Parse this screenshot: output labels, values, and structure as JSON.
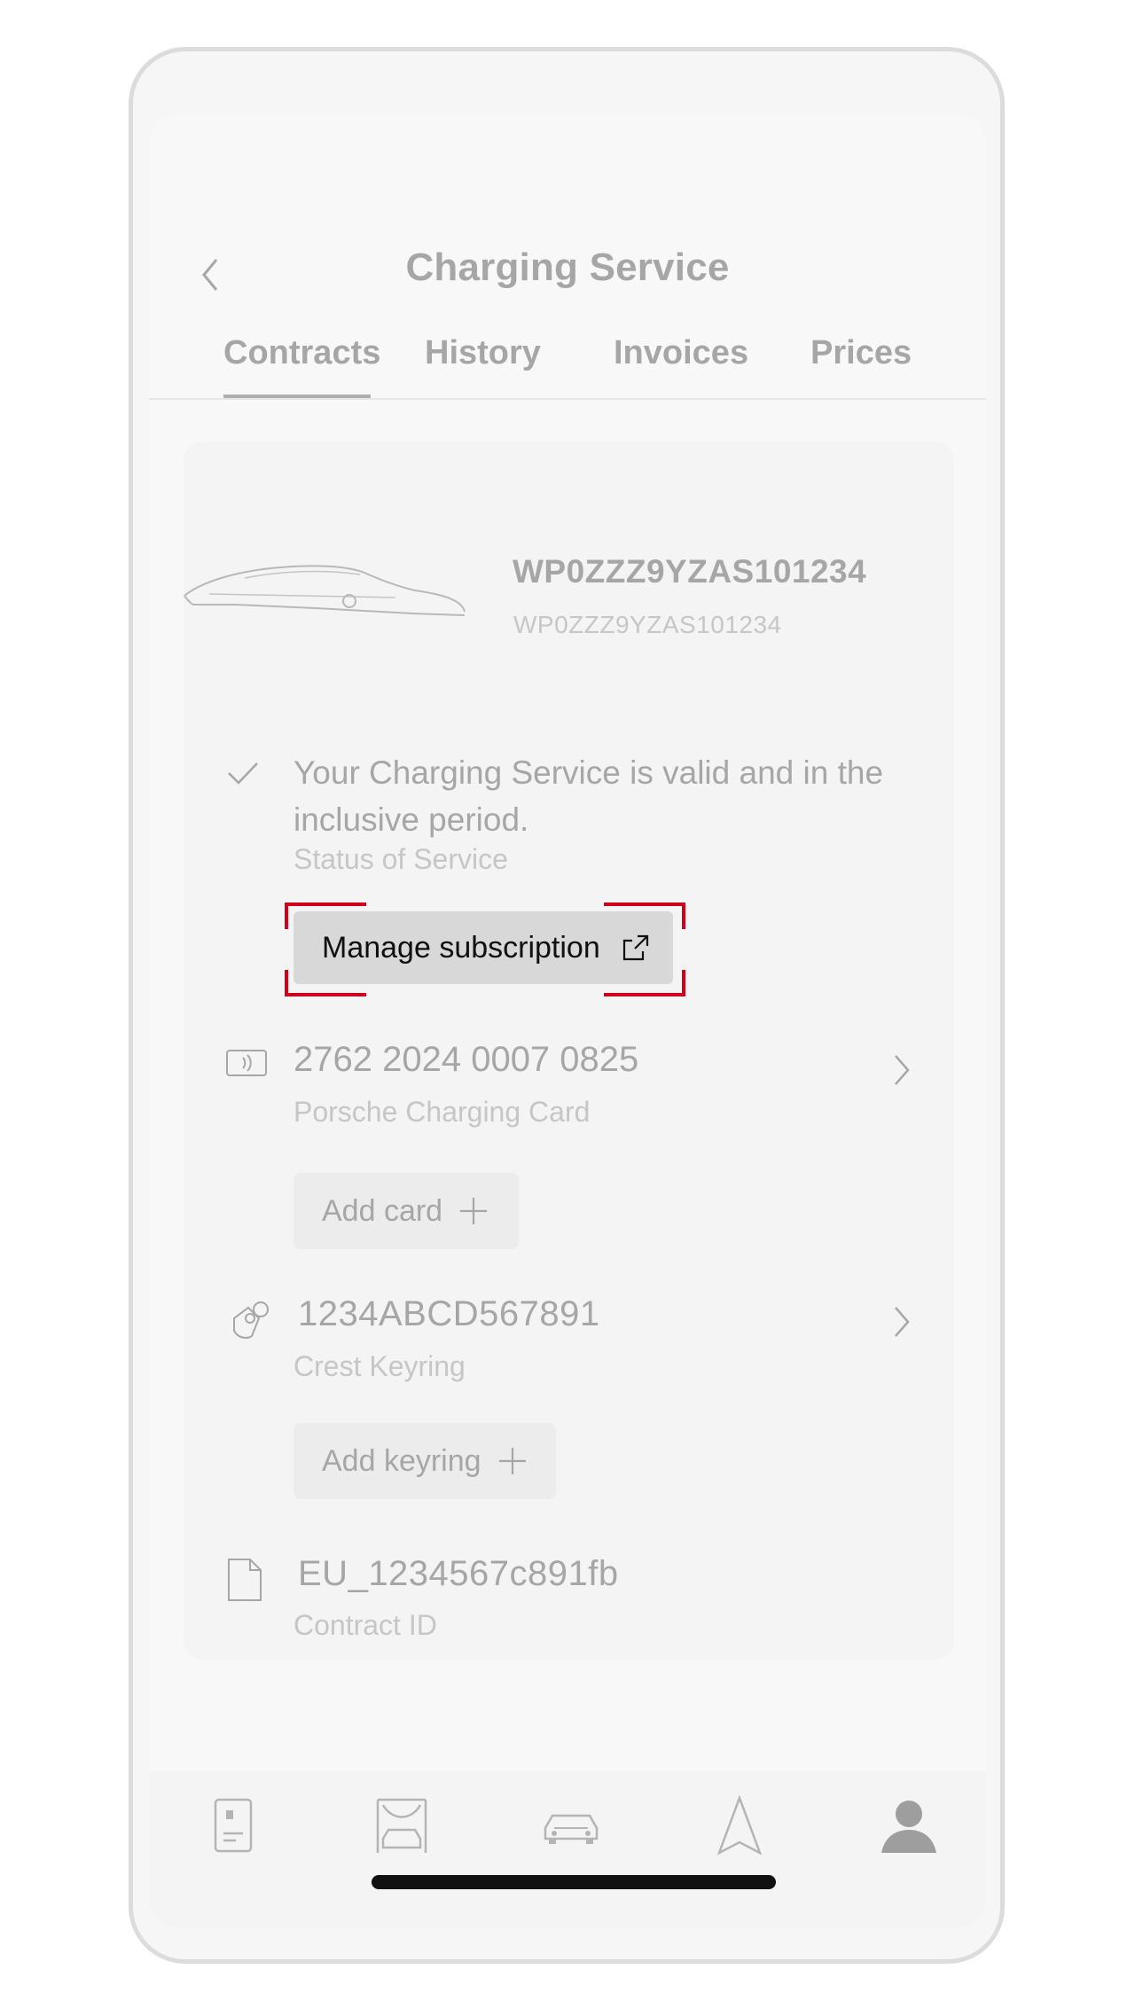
{
  "header": {
    "title": "Charging Service",
    "tabs": [
      {
        "label": "Contracts",
        "active": true
      },
      {
        "label": "History",
        "active": false
      },
      {
        "label": "Invoices",
        "active": false
      },
      {
        "label": "Prices",
        "active": false
      }
    ]
  },
  "vehicle": {
    "vin_primary": "WP0ZZZ9YZAS101234",
    "vin_secondary": "WP0ZZZ9YZAS101234"
  },
  "service_status": {
    "text": "Your Charging Service is valid and in the inclusive period.",
    "label": "Status of Service",
    "manage_button": "Manage subscription"
  },
  "charging_card": {
    "number": "2762 2024 0007 0825",
    "label": "Porsche Charging Card",
    "add_button": "Add card"
  },
  "keyring": {
    "number": "1234ABCD567891",
    "label": "Crest Keyring",
    "add_button": "Add keyring"
  },
  "contract": {
    "id": "EU_1234567c891fb",
    "label": "Contract ID"
  },
  "bottom_nav": {
    "items": [
      "phone-icon",
      "charging-station-icon",
      "car-icon",
      "navigation-icon",
      "profile-icon"
    ]
  },
  "colors": {
    "highlight": "#d0021b",
    "muted_text": "#a6a6a6",
    "faint_text": "#c6c6c6",
    "button_bg": "#d8d8d8"
  }
}
